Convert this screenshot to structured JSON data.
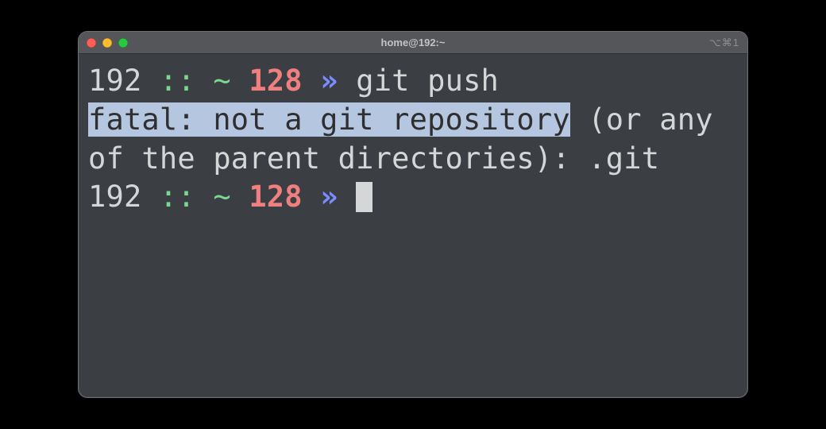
{
  "titlebar": {
    "title": "home@192:~",
    "shortcut": "⌥⌘1"
  },
  "colors": {
    "bg": "#3b3f44",
    "fg": "#d5d6d7",
    "green": "#7bd88f",
    "red": "#f07f7f",
    "blue": "#7a8cff",
    "selection": "#b5c6e0"
  },
  "prompt": {
    "host": "192",
    "separator": "::",
    "cwd": "~",
    "exit_code": "128",
    "symbol": "»"
  },
  "lines": {
    "command": "git push",
    "output_selected": "fatal: not a git repository",
    "output_rest": " (or any of the parent directories): .git"
  }
}
